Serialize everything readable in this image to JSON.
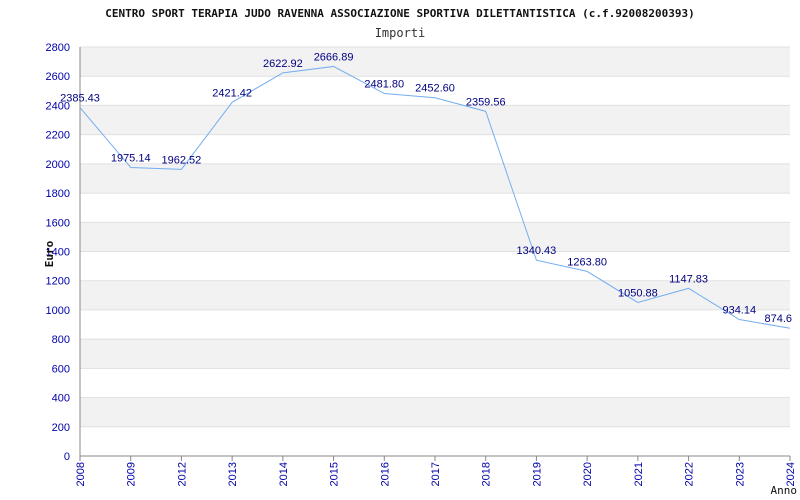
{
  "colors": {
    "line": "#74aef0",
    "band": "#f2f2f2",
    "grid": "#e0e0e0",
    "axis": "#888888",
    "tick_text": "#0000aa",
    "data_label": "#000080"
  },
  "chart_data": {
    "type": "line",
    "title": "CENTRO SPORT TERAPIA JUDO RAVENNA ASSOCIAZIONE SPORTIVA DILETTANTISTICA (c.f.92008200393)",
    "subtitle": "Importi",
    "ylabel": "Euro",
    "xlabel": "Anno",
    "ylim": [
      0,
      2800
    ],
    "yticks": [
      "0",
      "200",
      "400",
      "600",
      "800",
      "1000",
      "1200",
      "1400",
      "1600",
      "1800",
      "2000",
      "2200",
      "2400",
      "2600",
      "2800"
    ],
    "grid": "horizontal, alternating bands",
    "categories": [
      "2008",
      "2009",
      "2012",
      "2013",
      "2014",
      "2015",
      "2016",
      "2017",
      "2018",
      "2019",
      "2020",
      "2021",
      "2022",
      "2023",
      "2024"
    ],
    "values": [
      2385.43,
      1975.14,
      1962.52,
      2421.42,
      2622.92,
      2666.89,
      2481.8,
      2452.6,
      2359.56,
      1340.43,
      1263.8,
      1050.88,
      1147.83,
      934.14,
      874.6
    ],
    "value_labels": [
      "2385.43",
      "1975.14",
      "1962.52",
      "2421.42",
      "2622.92",
      "2666.89",
      "2481.80",
      "2452.60",
      "2359.56",
      "1340.43",
      "1263.80",
      "1050.88",
      "1147.83",
      "934.14",
      "874.6"
    ]
  }
}
